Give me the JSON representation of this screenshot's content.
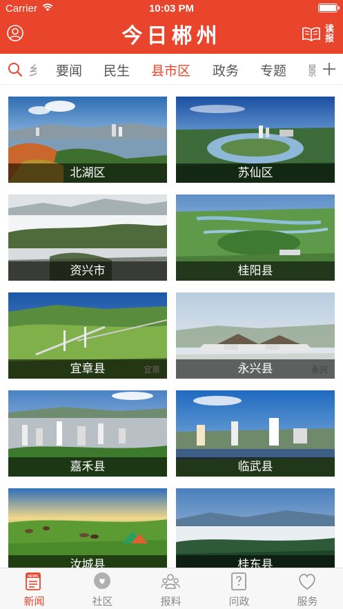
{
  "status_bar": {
    "carrier": "Carrier",
    "time": "10:03 PM",
    "battery_level": 1.0
  },
  "header": {
    "title": "今日郴州",
    "read_label": "读报"
  },
  "channels": {
    "partial_left": "乡",
    "items": [
      "要闻",
      "民生",
      "县市区",
      "政务",
      "专题"
    ],
    "partial_right": "影",
    "active": "县市区"
  },
  "regions": [
    "北湖区",
    "苏仙区",
    "资兴市",
    "桂阳县",
    "宜章县",
    "永兴县",
    "嘉禾县",
    "临武县",
    "汝城县",
    "桂东县"
  ],
  "watermarks": {
    "yizhang": "宜章",
    "yongxing": "永兴"
  },
  "tab_bar": {
    "items": [
      {
        "label": "新闻",
        "icon": "news-icon",
        "badge": "NEWS"
      },
      {
        "label": "社区",
        "icon": "chat-bubble-icon"
      },
      {
        "label": "报料",
        "icon": "people-icon"
      },
      {
        "label": "问政",
        "icon": "question-doc-icon"
      },
      {
        "label": "服务",
        "icon": "heart-icon"
      }
    ],
    "active": "新闻"
  },
  "colors": {
    "brand": "#e8452c",
    "inactive_tab": "#888888"
  }
}
